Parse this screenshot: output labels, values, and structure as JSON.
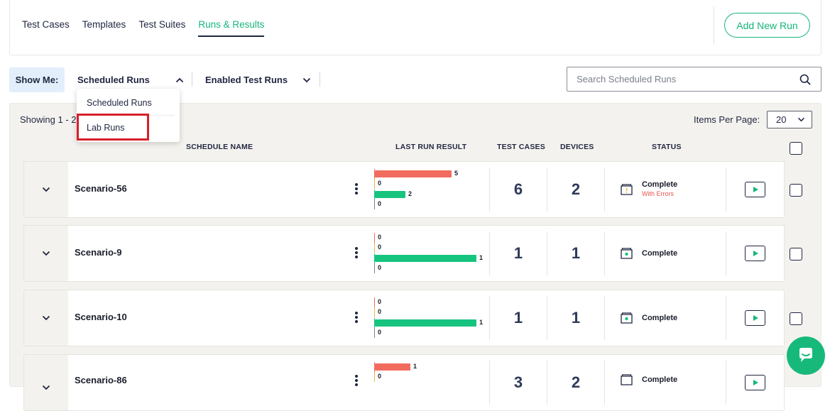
{
  "nav": {
    "tabs": [
      {
        "label": "Test Cases"
      },
      {
        "label": "Templates"
      },
      {
        "label": "Test Suites"
      },
      {
        "label": "Runs & Results"
      }
    ],
    "active_tab": "Runs & Results",
    "add_button": "Add New Run"
  },
  "filters": {
    "show_me_label": "Show Me:",
    "run_type": "Scheduled Runs",
    "enabled_filter": "Enabled Test Runs",
    "search_placeholder": "Search Scheduled Runs"
  },
  "dropdown": {
    "options": [
      "Scheduled Runs",
      "Lab Runs"
    ],
    "highlighted": "Lab Runs"
  },
  "results": {
    "showing": "Showing 1 - 2",
    "items_per_page_label": "Items Per Page:",
    "items_per_page": "20",
    "columns": {
      "schedule_name": "SCHEDULE NAME",
      "last_run_result": "LAST RUN RESULT",
      "test_cases": "TEST CASES",
      "devices": "DEVICES",
      "status": "STATUS"
    },
    "rows": [
      {
        "name": "Scenario-56",
        "results": [
          "5",
          "0",
          "2",
          "0"
        ],
        "test_cases": "6",
        "devices": "2",
        "status": "Complete",
        "status_sub": "With Errors"
      },
      {
        "name": "Scenario-9",
        "results": [
          "0",
          "0",
          "1",
          "0"
        ],
        "test_cases": "1",
        "devices": "1",
        "status": "Complete",
        "status_sub": ""
      },
      {
        "name": "Scenario-10",
        "results": [
          "0",
          "0",
          "1",
          "0"
        ],
        "test_cases": "1",
        "devices": "1",
        "status": "Complete",
        "status_sub": ""
      },
      {
        "name": "Scenario-86",
        "results": [
          "1",
          "0",
          "",
          ""
        ],
        "test_cases": "3",
        "devices": "2",
        "status": "Complete",
        "status_sub": ""
      }
    ]
  },
  "colors": {
    "accent": "#16b67a",
    "failed": "#f26b5f",
    "warning": "#f0b43c",
    "passed": "#16c47f",
    "skipped": "#7a7f8a",
    "highlight_box": "#d6202a"
  },
  "icons": [
    "chevron-up-icon",
    "chevron-down-icon",
    "search-icon",
    "expand-chevron-icon",
    "kebab-menu-icon",
    "status-folder-icon",
    "play-icon",
    "chat-icon"
  ]
}
